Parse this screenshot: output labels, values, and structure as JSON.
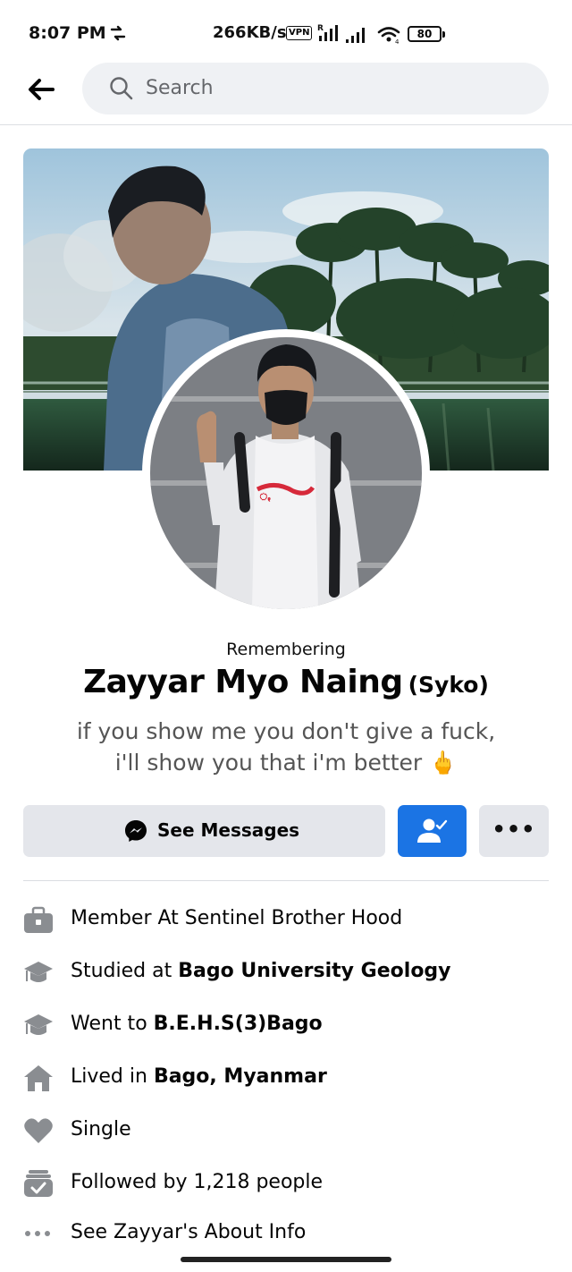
{
  "status_bar": {
    "time": "8:07 PM",
    "speed": "266KB/s",
    "vpn": "VPN",
    "battery": "80"
  },
  "search": {
    "placeholder": "Search"
  },
  "profile": {
    "remembering": "Remembering",
    "name": "Zayyar Myo Naing",
    "nickname": "(Syko)",
    "bio_line1": "if you show me you don't give a fuck,",
    "bio_line2": "i'll show you that i'm better 🖕"
  },
  "actions": {
    "messages_label": "See Messages",
    "more_label": "•••"
  },
  "colors": {
    "primary_button": "#1b74e4",
    "secondary_button": "#e4e6eb",
    "icon_gray": "#8a8d91"
  },
  "info": {
    "work": {
      "prefix": "Member At Sentinel Brother Hood",
      "bold": "",
      "icon": "briefcase-icon"
    },
    "college": {
      "prefix": "Studied at ",
      "bold": "Bago University Geology",
      "icon": "graduation-cap-icon"
    },
    "school": {
      "prefix": "Went to ",
      "bold": "B.E.H.S(3)Bago",
      "icon": "graduation-cap-icon"
    },
    "lived": {
      "prefix": "Lived in ",
      "bold": "Bago, Myanmar",
      "icon": "home-icon"
    },
    "relationship": {
      "prefix": "Single",
      "bold": "",
      "icon": "heart-icon"
    },
    "followers": {
      "prefix": "Followed by 1,218 people",
      "bold": "",
      "icon": "followers-icon"
    },
    "about": {
      "prefix": "See Zayyar's About Info",
      "bold": "",
      "icon": "more-dots-icon"
    }
  }
}
